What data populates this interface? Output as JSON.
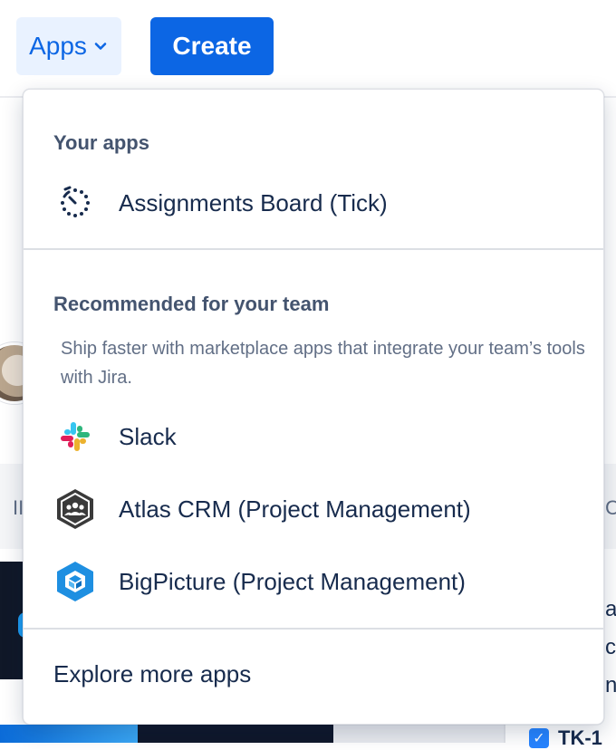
{
  "nav": {
    "apps_label": "Apps",
    "create_label": "Create"
  },
  "dropdown": {
    "your_apps_heading": "Your apps",
    "your_apps": [
      {
        "label": "Assignments Board (Tick)",
        "icon": "tick-clock-icon"
      }
    ],
    "recommended_heading": "Recommended for your team",
    "recommended_description": "Ship faster with marketplace apps that integrate your team’s tools with Jira.",
    "recommended": [
      {
        "label": "Slack",
        "icon": "slack-icon"
      },
      {
        "label": "Atlas CRM (Project Management)",
        "icon": "atlas-crm-icon"
      },
      {
        "label": "BigPicture (Project Management)",
        "icon": "bigpicture-icon"
      }
    ],
    "explore_label": "Explore more apps"
  },
  "background": {
    "left_peek_text": "II",
    "right_peek_text": "C",
    "right_lines": [
      "a",
      "c",
      "n"
    ],
    "ticket_key": "TK-1"
  },
  "colors": {
    "brand_blue": "#0c66e4",
    "apps_button_bg": "#e9f2ff",
    "text_primary": "#172b4d",
    "text_subtle": "#44546f"
  }
}
